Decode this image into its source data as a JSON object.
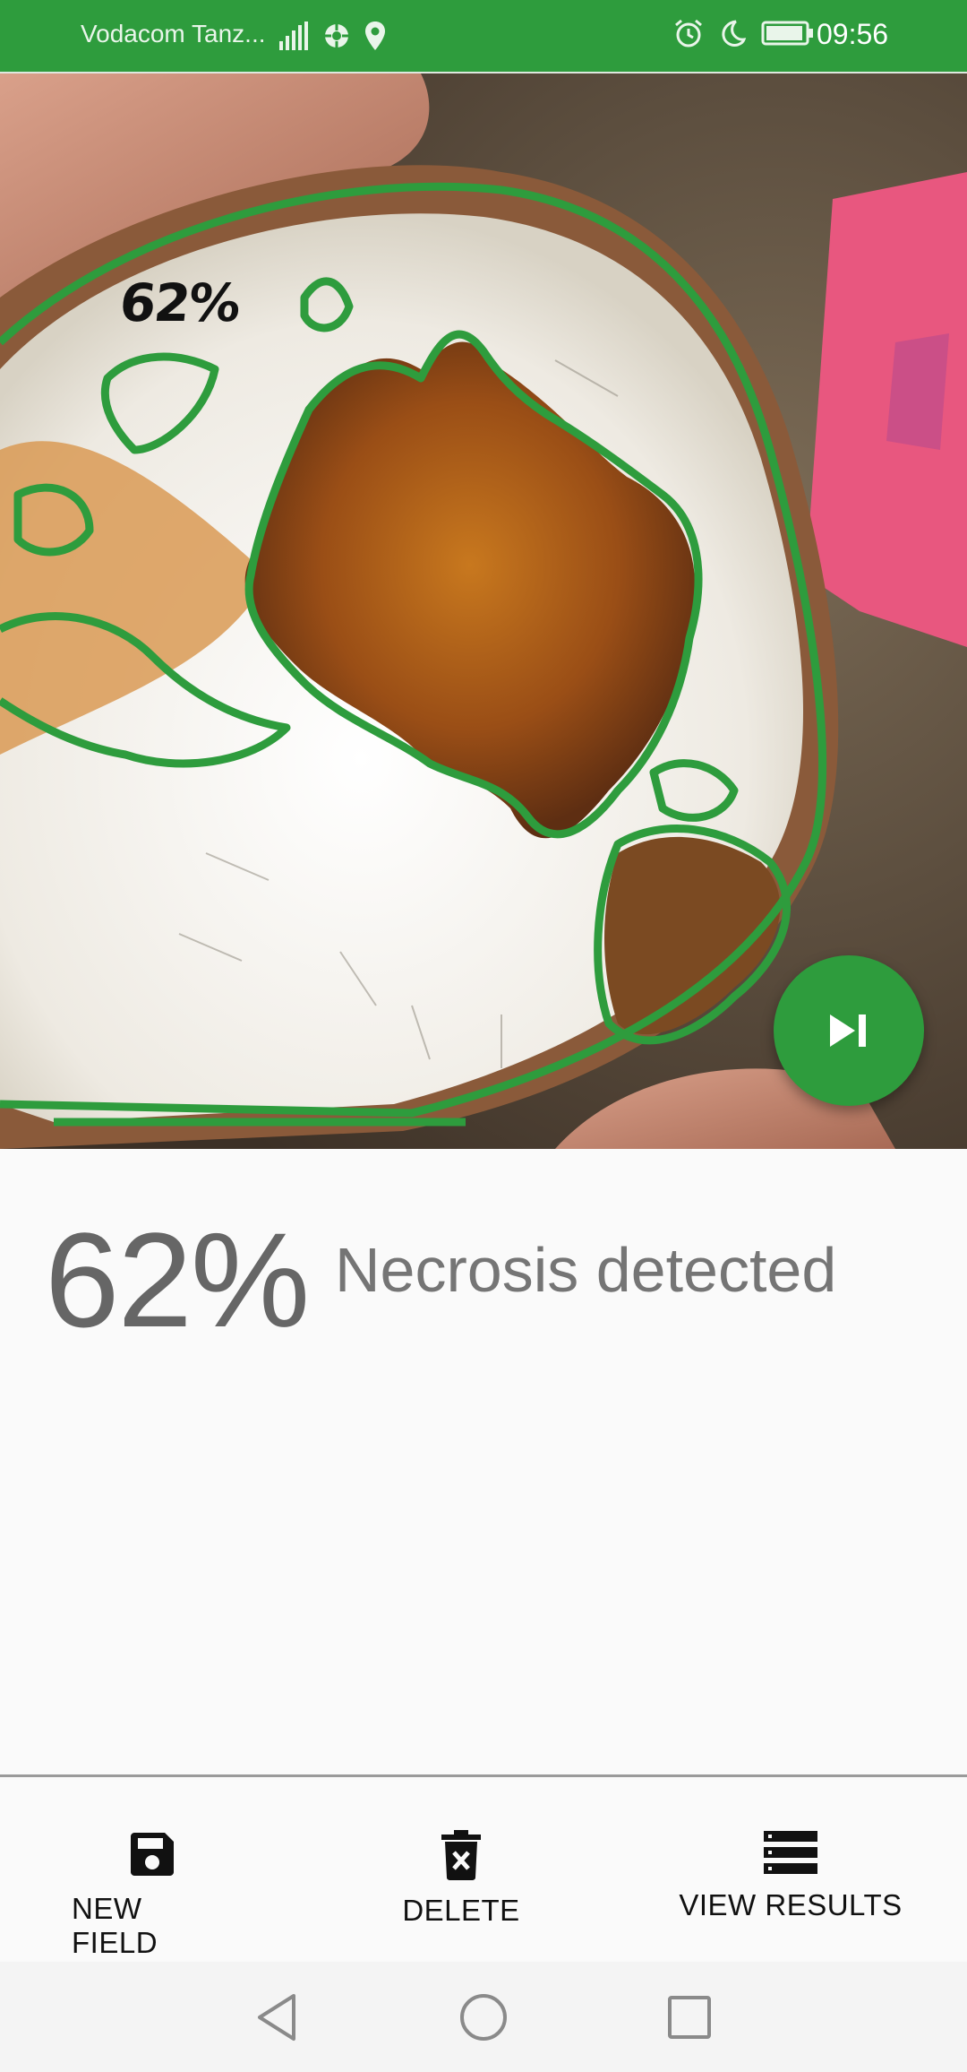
{
  "status_bar": {
    "carrier": "Vodacom Tanz...",
    "time": "09:56",
    "icons": [
      "signal-icon",
      "data-icon",
      "location-icon",
      "alarm-icon",
      "moon-icon",
      "battery-icon"
    ]
  },
  "image": {
    "overlay_percentage": "62%",
    "fab_icon": "skip-next-icon"
  },
  "result": {
    "percentage": "62%",
    "label": "Necrosis detected"
  },
  "bottom_actions": [
    {
      "label": "NEW FIELD",
      "icon": "save-icon"
    },
    {
      "label": "DELETE",
      "icon": "delete-icon"
    },
    {
      "label": "VIEW RESULTS",
      "icon": "list-icon"
    }
  ],
  "nav": [
    "back-icon",
    "home-icon",
    "recents-icon"
  ],
  "colors": {
    "accent_green": "#2e9c3d",
    "text_gray": "#666666"
  }
}
